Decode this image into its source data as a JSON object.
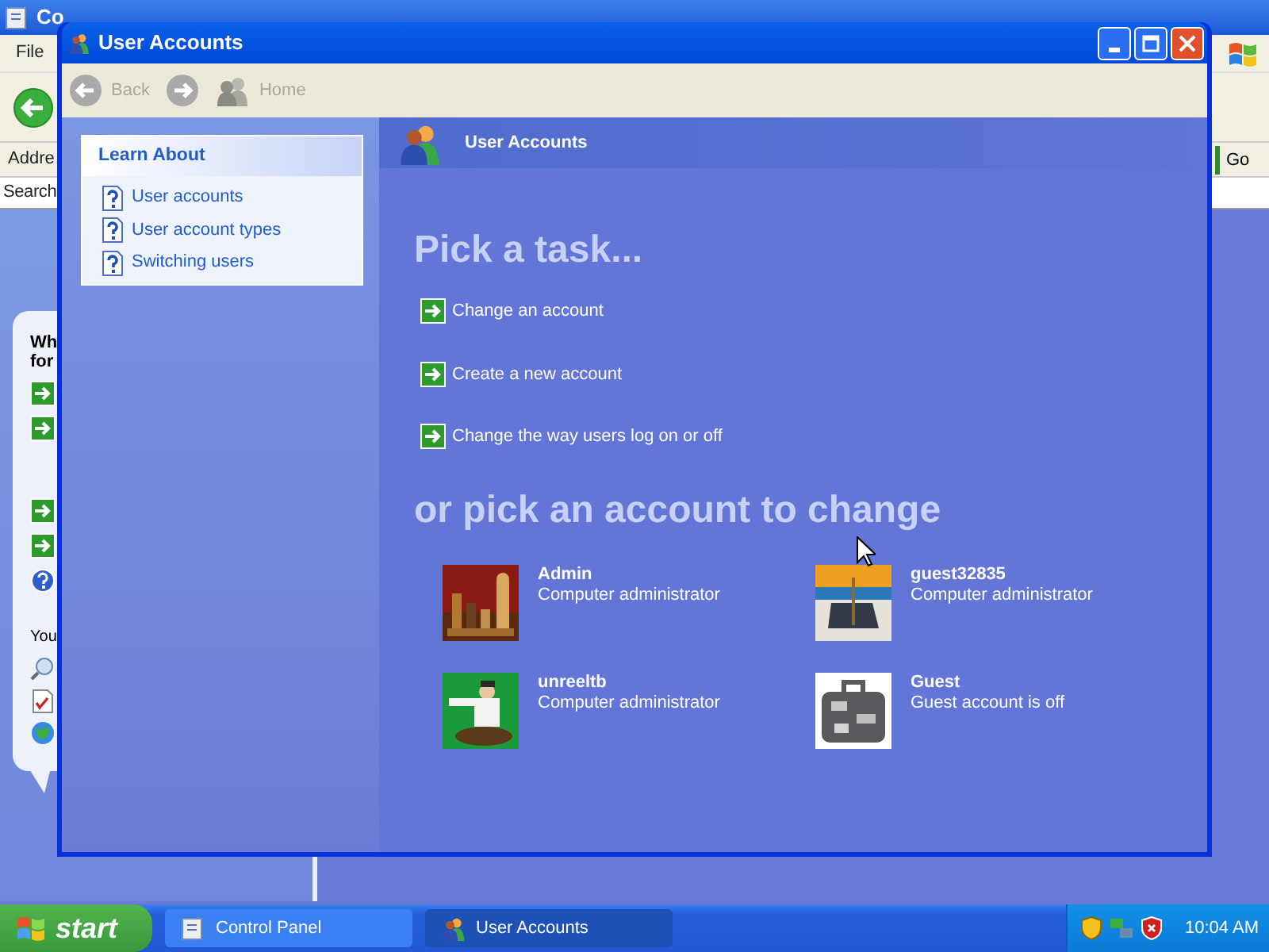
{
  "background_window": {
    "title": "Co",
    "menu": [
      "File"
    ],
    "address_label": "Addre",
    "go_button": "Go",
    "search_label": "Search",
    "task_pane": {
      "heading_lines": [
        "Wh",
        "for"
      ],
      "section_label": "You"
    }
  },
  "window": {
    "title": "User Accounts"
  },
  "toolbar": [
    {
      "kind": "back",
      "label": "Back",
      "disabled": true
    },
    {
      "kind": "forward",
      "disabled": true
    },
    {
      "kind": "home",
      "label": "Home",
      "disabled": true
    }
  ],
  "sidebar": {
    "title": "Learn About",
    "items": [
      "User accounts",
      "User account types",
      "Switching users"
    ]
  },
  "header": {
    "title": "User Accounts"
  },
  "task_heading": "Pick a task...",
  "tasks": [
    "Change an account",
    "Create a new account",
    "Change the way users log on or off"
  ],
  "account_heading": "or pick an account to change",
  "accounts": [
    {
      "name": "Admin",
      "description": "Computer administrator"
    },
    {
      "name": "guest32835",
      "description": "Computer administrator"
    },
    {
      "name": "unreeltb",
      "description": "Computer administrator"
    },
    {
      "name": "Guest",
      "description": "Guest account is off"
    }
  ],
  "taskbar": {
    "start": "start",
    "tasks": [
      {
        "label": "Control Panel",
        "selected": false
      },
      {
        "label": "User Accounts",
        "selected": true
      }
    ],
    "clock": "10:04 AM"
  }
}
